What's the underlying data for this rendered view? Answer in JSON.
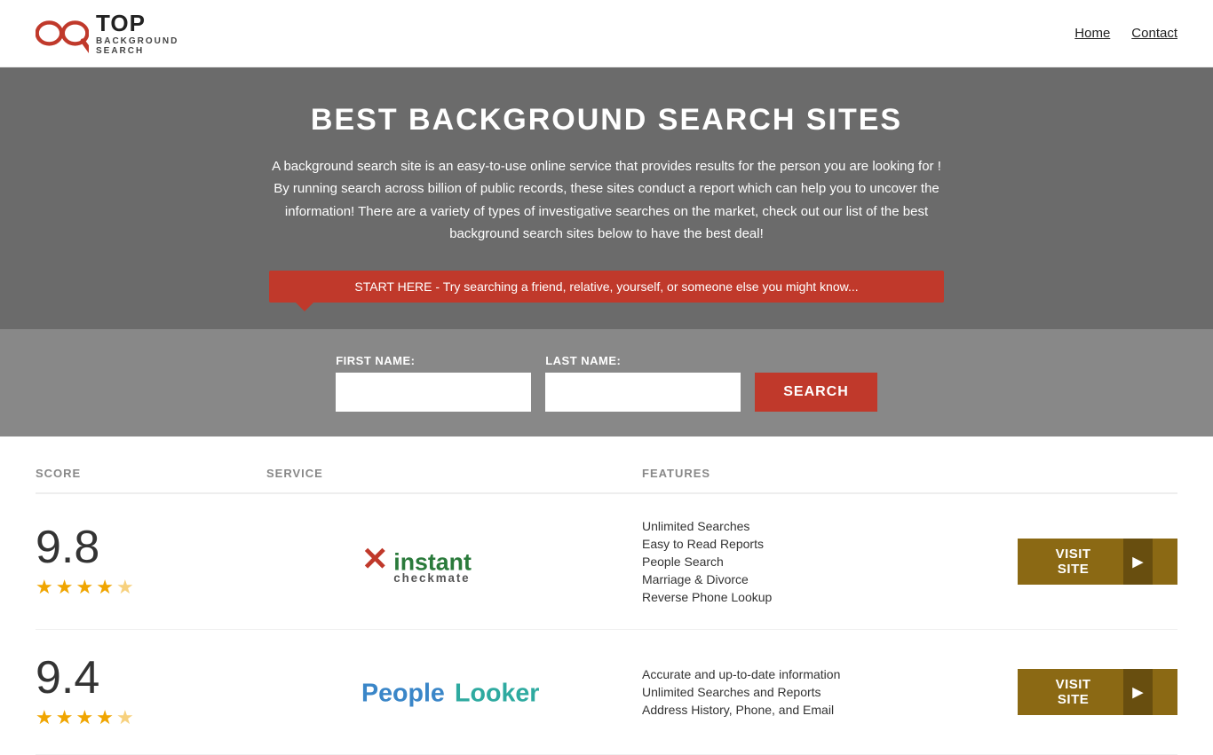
{
  "header": {
    "logo_top": "TOP",
    "logo_sub": "BACKGROUND\nSEARCH",
    "nav_home": "Home",
    "nav_contact": "Contact"
  },
  "hero": {
    "title": "BEST BACKGROUND SEARCH SITES",
    "description": "A background search site is an easy-to-use online service that provides results  for the person you are looking for ! By  running  search across billion of public records, these sites conduct  a report which can help you to uncover the information! There are a variety of types of investigative searches on the market, check out our  list of the best background search sites below to have the best deal!",
    "search_prompt": "START HERE - Try searching a friend, relative, yourself, or someone else you might know...",
    "first_name_label": "FIRST NAME:",
    "last_name_label": "LAST NAME:",
    "search_button": "SEARCH"
  },
  "table": {
    "col_score": "SCORE",
    "col_service": "SERVICE",
    "col_features": "FEATURES",
    "col_action": ""
  },
  "rows": [
    {
      "score": "9.8",
      "stars": 4.5,
      "service_name": "Instant Checkmate",
      "features": [
        "Unlimited Searches",
        "Easy to Read Reports",
        "People Search",
        "Marriage & Divorce",
        "Reverse Phone Lookup"
      ],
      "visit_label": "VISIT SITE"
    },
    {
      "score": "9.4",
      "stars": 4.5,
      "service_name": "PeopleLooker",
      "features": [
        "Accurate and up-to-date information",
        "Unlimited Searches and Reports",
        "Address History, Phone, and Email"
      ],
      "visit_label": "VISIT SITE"
    }
  ]
}
